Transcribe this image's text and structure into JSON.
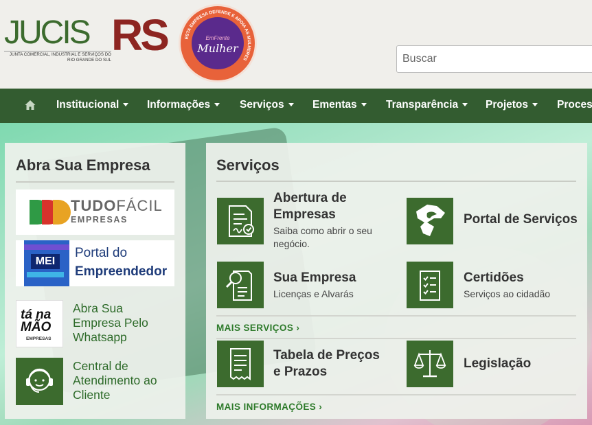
{
  "header": {
    "logo_jucis": "JUCIS",
    "logo_rs": "RS",
    "logo_subtitle": "JUNTA COMERCIAL, INDUSTRIAL E SERVIÇOS DO RIO GRANDE DO SUL",
    "seal_ring": "ESTA EMPRESA DEFENDE E APOIA AS MULHERES",
    "seal_em": "EmFrente",
    "seal_mulher": "Mulher",
    "search_placeholder": "Buscar"
  },
  "nav": {
    "items": [
      {
        "label": "Institucional"
      },
      {
        "label": "Informações"
      },
      {
        "label": "Serviços"
      },
      {
        "label": "Ementas"
      },
      {
        "label": "Transparência"
      },
      {
        "label": "Projetos"
      },
      {
        "label": "Process"
      }
    ]
  },
  "left_panel": {
    "title": "Abra Sua Empresa",
    "tudo_title_bold": "TUDO",
    "tudo_title_light": "FÁCIL",
    "tudo_sub": "EMPRESAS",
    "mei_tag": "MEI",
    "mei_line1": "Portal do",
    "mei_line2": "Empreendedor",
    "taname_logo": "tá na MÃO",
    "taname_sub": "EMPRESAS",
    "whatsapp_lines": [
      "Abra Sua",
      "Empresa Pelo",
      "Whatsapp"
    ],
    "central_lines": [
      "Central de",
      "Atendimento ao",
      "Cliente"
    ]
  },
  "right_panel": {
    "title": "Serviços",
    "services": [
      {
        "title1": "Abertura de",
        "title2": "Empresas",
        "sub1": "Saiba como abrir o seu",
        "sub2": "negócio."
      },
      {
        "title1": "Portal de Serviços"
      },
      {
        "title1": "Sua Empresa",
        "sub1": "Licenças e Alvarás"
      },
      {
        "title1": "Certidões",
        "sub1": "Serviços ao cidadão"
      },
      {
        "title1": "Tabela de Preços",
        "title2": "e Prazos"
      },
      {
        "title1": "Legislação"
      }
    ],
    "more_services": "MAIS SERVIÇOS  ›",
    "more_info": "MAIS INFORMAÇÕES  ›"
  },
  "colors": {
    "brand_green": "#3c6b2e",
    "nav_green": "#335c30",
    "brand_red": "#8d2521",
    "seal_orange": "#e8623a",
    "seal_purple": "#5a2a8c",
    "link_green": "#2d7a2a"
  }
}
